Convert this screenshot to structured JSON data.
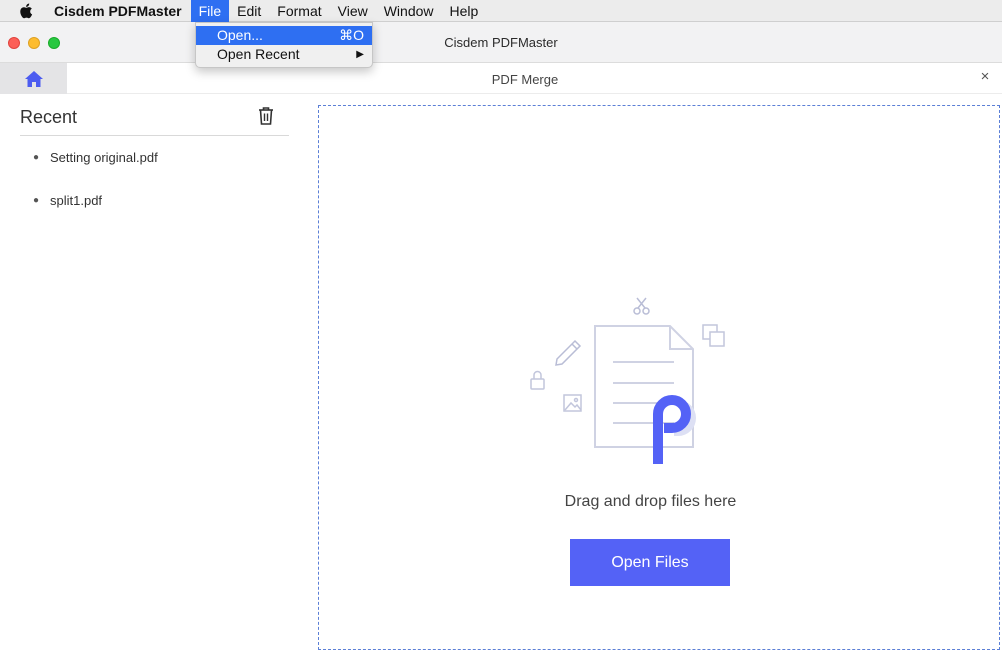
{
  "menubar": {
    "app_name": "Cisdem PDFMaster",
    "items": [
      "File",
      "Edit",
      "Format",
      "View",
      "Window",
      "Help"
    ]
  },
  "file_menu": {
    "items": [
      {
        "label": "Open...",
        "shortcut": "⌘O"
      },
      {
        "label": "Open Recent",
        "shortcut": "▶"
      }
    ]
  },
  "window": {
    "title": "Cisdem PDFMaster"
  },
  "tab": {
    "title": "PDF Merge",
    "close_glyph": "×"
  },
  "sidebar": {
    "title": "Recent",
    "files": [
      "Setting original.pdf",
      "split1.pdf"
    ]
  },
  "dropzone": {
    "hint": "Drag and drop files here",
    "button_label": "Open Files"
  },
  "colors": {
    "accent": "#5462f6",
    "menu_highlight": "#2e6ff2",
    "dash_border": "#5b7fd6"
  }
}
